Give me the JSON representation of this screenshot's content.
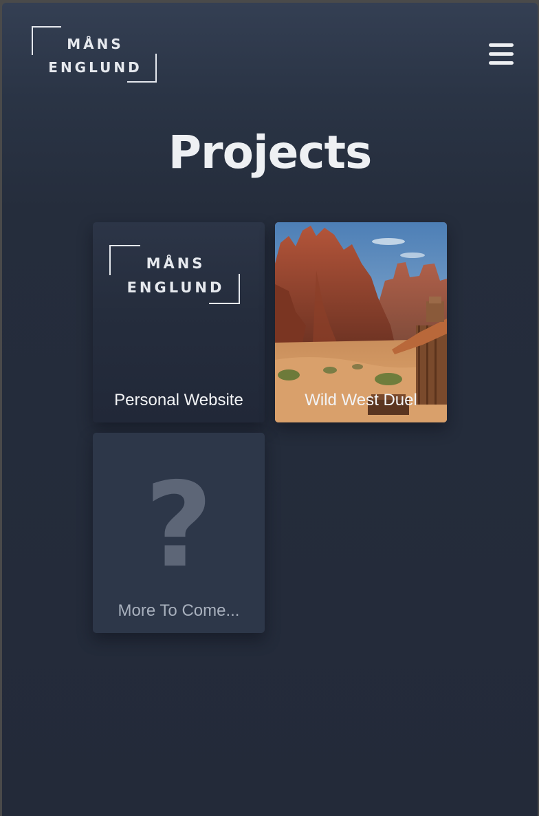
{
  "header": {
    "logo": {
      "line1": "MÅNS",
      "line2": "ENGLUND"
    },
    "menu_icon": "hamburger-menu-icon"
  },
  "page": {
    "title": "Projects"
  },
  "projects": [
    {
      "label": "Personal Website",
      "thumbnail": {
        "type": "logo",
        "line1": "MÅNS",
        "line2": "ENGLUND"
      }
    },
    {
      "label": "Wild West Duel",
      "thumbnail": {
        "type": "image",
        "description_icon": "desert-canyon-image"
      }
    },
    {
      "label": "More To Come...",
      "thumbnail": {
        "type": "glyph",
        "glyph": "?"
      }
    }
  ],
  "colors": {
    "background": "#232a39",
    "card": "#2d3749",
    "text": "#eef0f3",
    "muted_text": "#a8b0bd",
    "placeholder_glyph": "#5d6677"
  }
}
